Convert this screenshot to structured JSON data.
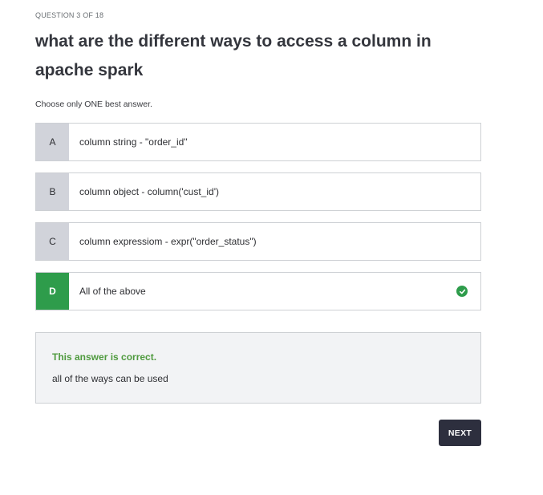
{
  "quiz": {
    "question_counter": "QUESTION 3 OF 18",
    "question_title": "what are the different ways to access a column in apache spark",
    "instruction": "Choose only ONE best answer."
  },
  "options": [
    {
      "letter": "A",
      "text": "column string - \"order_id\"",
      "correct": false
    },
    {
      "letter": "B",
      "text": "column object - column('cust_id')",
      "correct": false
    },
    {
      "letter": "C",
      "text": "column expressiom - expr(\"order_status\")",
      "correct": false
    },
    {
      "letter": "D",
      "text": "All of the above",
      "correct": true,
      "icon": "check-circle-icon"
    }
  ],
  "feedback": {
    "title": "This answer is correct.",
    "explanation": "all of the ways can be used"
  },
  "actions": {
    "next_label": "NEXT"
  },
  "colors": {
    "correct_green": "#2e9c4b",
    "feedback_green": "#4f9a3e",
    "letter_bg": "#d1d3da",
    "button_dark": "#2d2f3e",
    "feedback_bg": "#f2f3f5"
  }
}
